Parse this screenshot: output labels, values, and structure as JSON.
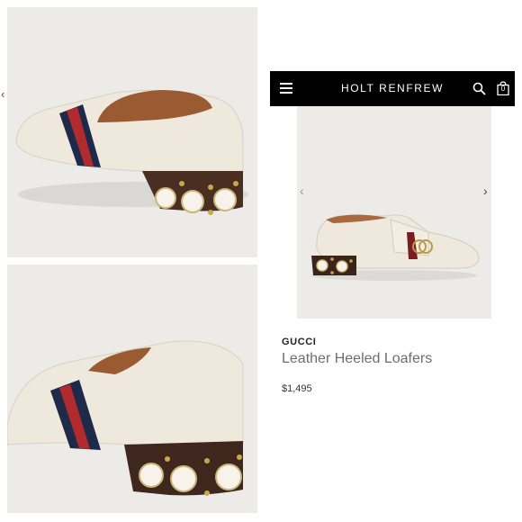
{
  "header": {
    "brand": "HOLT RENFREW",
    "bag_count": "0"
  },
  "product": {
    "designer": "GUCCI",
    "name": "Leather Heeled Loafers",
    "price": "$1,495"
  },
  "carousel": {
    "prev_glyph": "‹",
    "next_glyph": "›"
  },
  "side_glyph": "‹",
  "icons": [
    "hamburger-menu-icon",
    "search-icon",
    "shopping-bag-icon",
    "chevron-left-icon",
    "chevron-right-icon"
  ]
}
